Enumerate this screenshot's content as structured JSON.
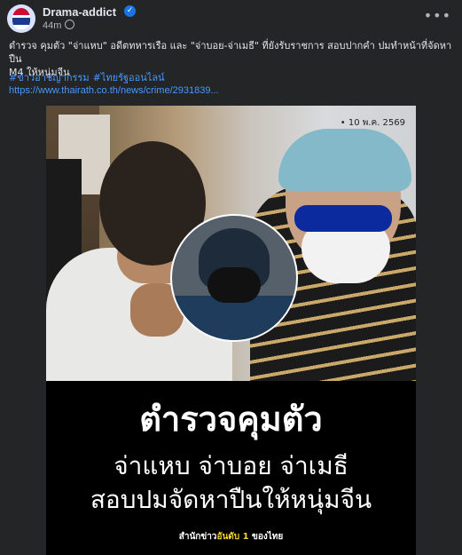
{
  "header": {
    "page_name": "Drama-addict",
    "time": "44m",
    "verified_icon": "verified-badge-icon",
    "more_icon": "more-options-icon"
  },
  "post": {
    "text_line1": "ตำรวจ คุมตัว \"จ่าแหบ\" อดีตทหารเรือ และ \"จ่าบอย-จ่าเมธี\" ที่ยังรับราชการ สอบปากคำ ปมทำหน้าที่จัดหาปืน",
    "text_line2": "M4 ให้หนุ่มจีน",
    "hashtag1": "#ข่าวอาชญากรรม",
    "hashtag2": "#ไทยรัฐออนไลน์",
    "link": "https://www.thairath.co.th/news/crime/2931839..."
  },
  "media": {
    "date_stamp": "• 10 พ.ค. 2569",
    "headline1": "ตำรวจคุมตัว",
    "headline2": "จ่าแหบ จ่าบอย จ่าเมธี",
    "headline3": "สอบปมจัดหาปืนให้หนุ่มจีน",
    "footer_pre": "สำนักข่าว",
    "footer_highlight": "อันดับ 1",
    "footer_post": " ของไทย"
  },
  "colors": {
    "background": "#242526",
    "link": "#4599ff",
    "highlight": "#f6d32d"
  }
}
